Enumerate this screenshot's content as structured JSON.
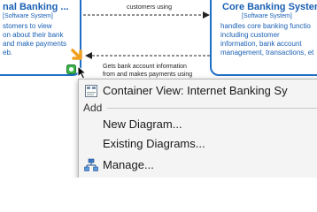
{
  "diagram": {
    "left_system": {
      "title": "nal Banking ...",
      "subtitle": "[Software System]",
      "desc_lines": [
        "stomers to view",
        "on about their bank",
        "and make payments",
        "eb."
      ]
    },
    "right_system": {
      "title": "Core Banking Syster",
      "subtitle": "[Software System]",
      "desc_lines": [
        "handles core banking functio",
        "including customer",
        "information, bank account",
        "management, transactions, et"
      ]
    },
    "relationships": {
      "top_label": "customers using",
      "bottom_label_lines": [
        "Gets bank account information",
        "from and makes payments using"
      ]
    },
    "colors": {
      "system_border": "#1f6fc5",
      "system_text": "#1a5fb4",
      "selection_arrow": "#f0a020",
      "nav_icon": "#3bb54a"
    }
  },
  "context_menu": {
    "items": [
      {
        "label": "Container View: Internet Banking Sy",
        "icon": "diagram-icon"
      },
      {
        "section": "Add"
      },
      {
        "label": "New Diagram..."
      },
      {
        "label": "Existing Diagrams..."
      },
      {
        "label": "Manage...",
        "icon": "hierarchy-icon"
      }
    ]
  }
}
